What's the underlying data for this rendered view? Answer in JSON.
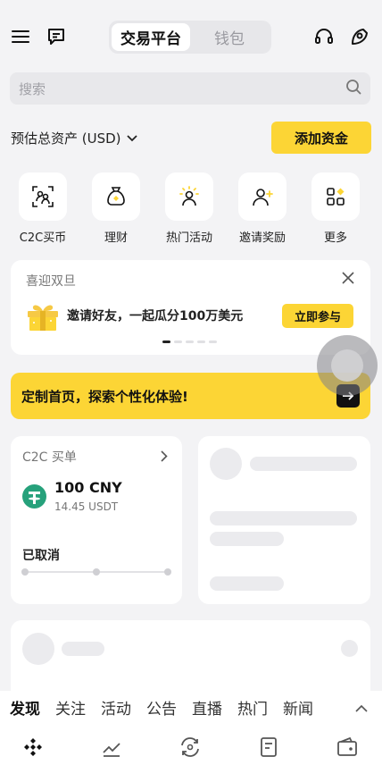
{
  "header": {
    "segments": [
      "交易平台",
      "钱包"
    ],
    "active_segment": "交易平台"
  },
  "search": {
    "placeholder": "搜索"
  },
  "assets": {
    "label": "预估总资产 (USD)",
    "add_funds_label": "添加资金"
  },
  "shortcuts": [
    {
      "label": "C2C买币",
      "icon": "c2c-icon"
    },
    {
      "label": "理财",
      "icon": "earn-icon"
    },
    {
      "label": "热门活动",
      "icon": "activity-icon"
    },
    {
      "label": "邀请奖励",
      "icon": "invite-icon"
    },
    {
      "label": "更多",
      "icon": "more-icon"
    }
  ],
  "promo": {
    "title": "喜迎双旦",
    "text": "邀请好友，一起瓜分100万美元",
    "button": "立即参与"
  },
  "banner": {
    "text": "定制首页，探索个性化体验!"
  },
  "c2c_card": {
    "title": "C2C 买单",
    "amount": "100 CNY",
    "sub_amount": "14.45 USDT",
    "status": "已取消"
  },
  "feed_tabs": [
    "发现",
    "关注",
    "活动",
    "公告",
    "直播",
    "热门",
    "新闻"
  ],
  "colors": {
    "accent": "#fcd535",
    "background": "#f3f3f5",
    "tether": "#26a17b"
  }
}
